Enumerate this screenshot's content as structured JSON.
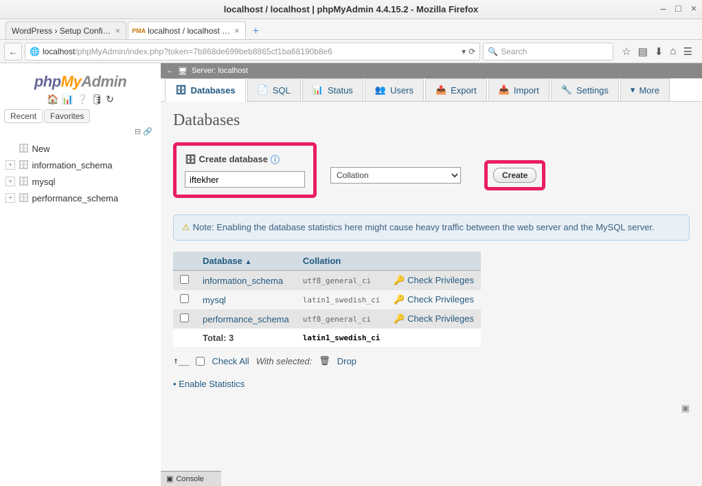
{
  "window": {
    "title": "localhost / localhost | phpMyAdmin 4.4.15.2 - Mozilla Firefox"
  },
  "browser_tabs": [
    {
      "label": "WordPress › Setup Confi…",
      "active": false
    },
    {
      "label": "localhost / localhost …",
      "active": true
    }
  ],
  "url": {
    "host": "localhost",
    "path": "/phpMyAdmin/index.php?token=7b868de699beb8865cf1ba68190b8e6"
  },
  "search_placeholder": "Search",
  "logo": {
    "p1": "php",
    "p2": "My",
    "p3": "Admin"
  },
  "sidebar_tabs": {
    "recent": "Recent",
    "favorites": "Favorites"
  },
  "tree": [
    {
      "label": "New",
      "expandable": false
    },
    {
      "label": "information_schema",
      "expandable": true
    },
    {
      "label": "mysql",
      "expandable": true
    },
    {
      "label": "performance_schema",
      "expandable": true
    }
  ],
  "server_bar": "Server: localhost",
  "top_tabs": [
    {
      "label": "Databases",
      "active": true
    },
    {
      "label": "SQL"
    },
    {
      "label": "Status"
    },
    {
      "label": "Users"
    },
    {
      "label": "Export"
    },
    {
      "label": "Import"
    },
    {
      "label": "Settings"
    },
    {
      "label": "More"
    }
  ],
  "page": {
    "title": "Databases",
    "create_label": "Create database",
    "db_name_value": "iftekher",
    "collation_label": "Collation",
    "create_btn": "Create",
    "note": "Note: Enabling the database statistics here might cause heavy traffic between the web server and the MySQL server.",
    "table": {
      "headers": {
        "database": "Database",
        "collation": "Collation"
      },
      "rows": [
        {
          "name": "information_schema",
          "collation": "utf8_general_ci",
          "action": "Check Privileges"
        },
        {
          "name": "mysql",
          "collation": "latin1_swedish_ci",
          "action": "Check Privileges"
        },
        {
          "name": "performance_schema",
          "collation": "utf8_general_ci",
          "action": "Check Privileges"
        }
      ],
      "total_label": "Total: 3",
      "total_collation": "latin1_swedish_ci"
    },
    "check_all": "Check All",
    "with_selected": "With selected:",
    "drop": "Drop",
    "enable_stats": "Enable Statistics"
  },
  "console": "Console"
}
